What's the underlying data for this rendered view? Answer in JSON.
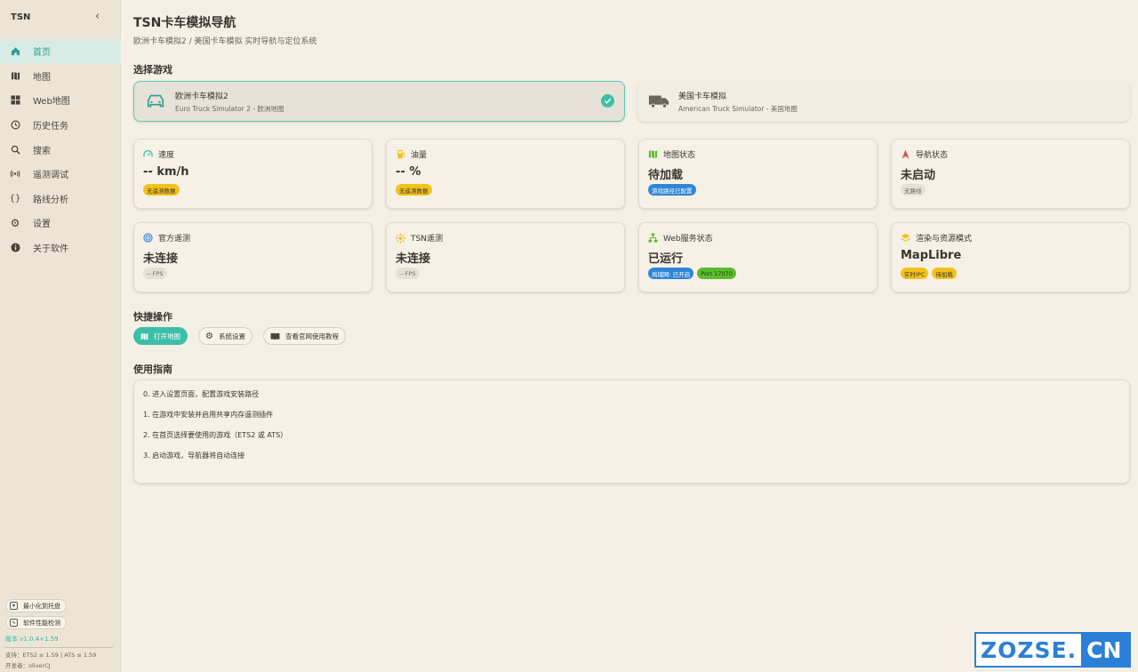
{
  "sidebar": {
    "brand": "TSN",
    "collapse_icon": "chevron-left-icon",
    "items": [
      {
        "label": "首页",
        "icon": "home-icon"
      },
      {
        "label": "地图",
        "icon": "map-icon"
      },
      {
        "label": "Web地图",
        "icon": "grid-icon"
      },
      {
        "label": "历史任务",
        "icon": "history-icon"
      },
      {
        "label": "搜索",
        "icon": "search-icon"
      },
      {
        "label": "遥测调试",
        "icon": "signal-icon"
      },
      {
        "label": "路线分析",
        "icon": "braces-icon"
      },
      {
        "label": "设置",
        "icon": "gear-icon"
      },
      {
        "label": "关于软件",
        "icon": "info-icon"
      }
    ],
    "minimize_label": "最小化到托盘",
    "perf_label": "软件性能检测",
    "version": "版本 v1.0.4+1.59",
    "support": "支持：ETS2 ≤ 1.59 | ATS ≤ 1.59",
    "author": "开发者：oliverCJ"
  },
  "header": {
    "title": "TSN卡车模拟导航",
    "subtitle": "欧洲卡车模拟2 / 美国卡车模拟 实时导航与定位系统"
  },
  "game_select": {
    "heading": "选择游戏",
    "games": [
      {
        "name": "欧洲卡车模拟2",
        "sub": "Euro Truck Simulator 2 - 欧洲地图",
        "selected": true
      },
      {
        "name": "美国卡车模拟",
        "sub": "American Truck Simulator - 美国地图",
        "selected": false
      }
    ]
  },
  "status_cards": [
    {
      "title": "速度",
      "value": "-- km/h",
      "icon": "gauge-icon",
      "icon_color": "#3cbfa9",
      "tags": [
        {
          "text": "无遥测数据",
          "color": "yellow"
        }
      ]
    },
    {
      "title": "油量",
      "value": "-- %",
      "icon": "fuel-icon",
      "icon_color": "#f2c21a",
      "tags": [
        {
          "text": "无遥测数据",
          "color": "yellow"
        }
      ]
    },
    {
      "title": "地图状态",
      "value": "待加载",
      "icon": "map-icon",
      "icon_color": "#5bbb2c",
      "tags": [
        {
          "text": "游戏路径已配置",
          "color": "blue"
        }
      ]
    },
    {
      "title": "导航状态",
      "value": "未启动",
      "icon": "nav-arrow-icon",
      "icon_color": "#d9534f",
      "tags": [
        {
          "text": "无路线",
          "color": "grey"
        }
      ]
    },
    {
      "title": "官方遥测",
      "value": "未连接",
      "icon": "target-icon",
      "icon_color": "#2f86d6",
      "tags": [
        {
          "text": "-- FPS",
          "color": "grey"
        }
      ]
    },
    {
      "title": "TSN遥测",
      "value": "未连接",
      "icon": "sparkle-icon",
      "icon_color": "#f2c21a",
      "tags": [
        {
          "text": "-- FPS",
          "color": "grey"
        }
      ]
    },
    {
      "title": "Web服务状态",
      "value": "已运行",
      "icon": "network-icon",
      "icon_color": "#5bbb2c",
      "tags": [
        {
          "text": "局域网: 已开启",
          "color": "blue"
        },
        {
          "text": "Port 17070",
          "color": "green"
        }
      ]
    },
    {
      "title": "渲染与资源模式",
      "value": "MapLibre",
      "icon": "layers-icon",
      "icon_color": "#f2c21a",
      "tags": [
        {
          "text": "实时IPC",
          "color": "yellow"
        },
        {
          "text": "待加载",
          "color": "yellow"
        }
      ]
    }
  ],
  "quick_actions": {
    "heading": "快捷操作",
    "buttons": [
      {
        "label": "打开地图",
        "icon": "map-icon",
        "primary": true
      },
      {
        "label": "系统设置",
        "icon": "gear-icon",
        "primary": false
      },
      {
        "label": "查看官网使用教程",
        "icon": "book-icon",
        "primary": false
      }
    ]
  },
  "guide": {
    "heading": "使用指南",
    "lines": [
      "0. 进入设置页面，配置游戏安装路径",
      "1. 在游戏中安装并启用共享内存遥测插件",
      "2. 在首页选择要使用的游戏（ETS2 或 ATS）",
      "3. 启动游戏，导航器将自动连接"
    ]
  },
  "watermark": {
    "part1": "ZOZSE.",
    "part2": "CN"
  }
}
